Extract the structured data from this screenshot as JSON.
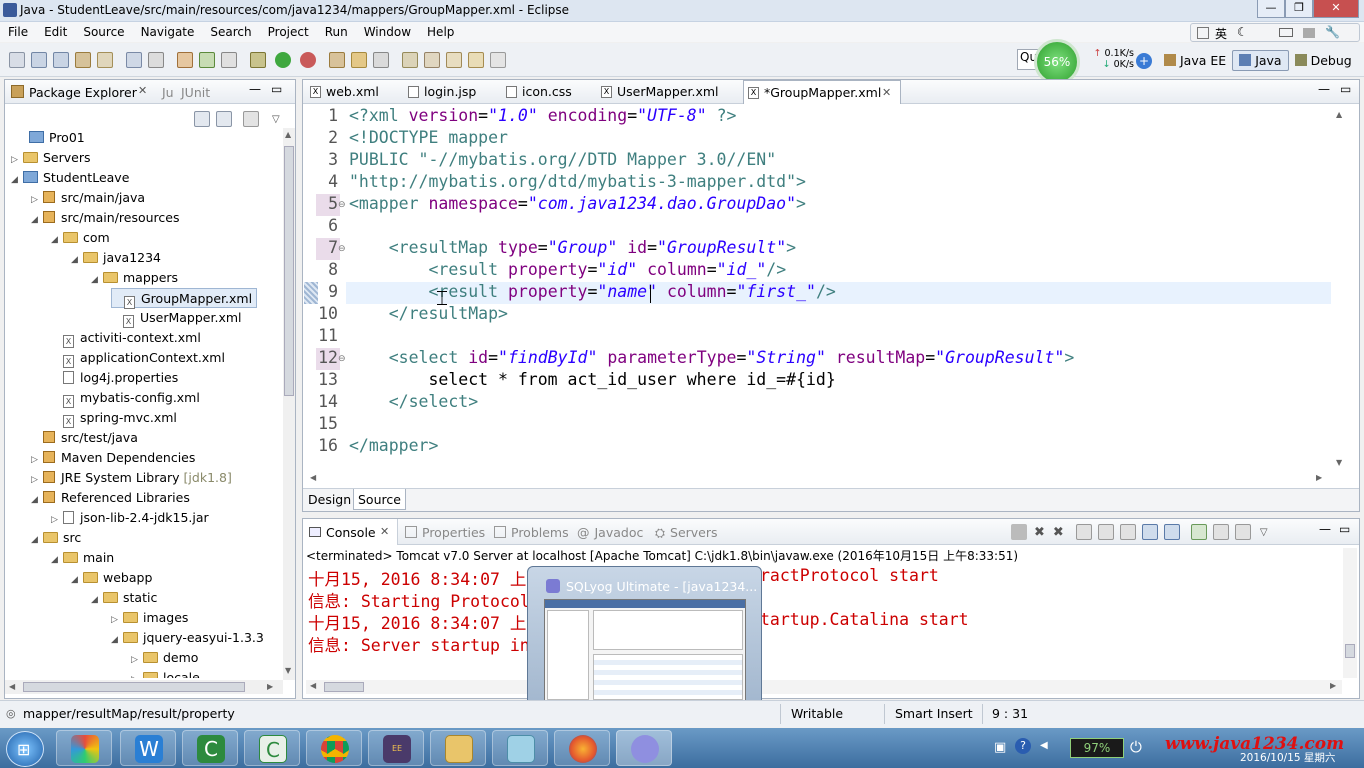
{
  "window": {
    "title": "Java - StudentLeave/src/main/resources/com/java1234/mappers/GroupMapper.xml - Eclipse"
  },
  "menu": [
    "File",
    "Edit",
    "Source",
    "Navigate",
    "Search",
    "Project",
    "Run",
    "Window",
    "Help"
  ],
  "toolbar": {
    "quick_access": "Qu",
    "cpu_percent": "56%",
    "net_up": "0.1K/s",
    "net_down": "0K/s",
    "perspectives": [
      "Java EE",
      "Java",
      "Debug"
    ],
    "ime": "英"
  },
  "package_explorer": {
    "title": "Package Explorer",
    "junit_tab": "JUnit",
    "tree": [
      {
        "label": "Pro01",
        "icon": "project-icon",
        "arrow": ""
      },
      {
        "label": "Servers",
        "icon": "folder-icon",
        "arrow": "▷"
      },
      {
        "label": "StudentLeave",
        "icon": "project-icon",
        "arrow": "◢"
      },
      {
        "label": "src/main/java",
        "icon": "package-folder-icon",
        "arrow": "▷"
      },
      {
        "label": "src/main/resources",
        "icon": "package-folder-icon",
        "arrow": "◢"
      },
      {
        "label": "com",
        "icon": "folder-icon",
        "arrow": "◢"
      },
      {
        "label": "java1234",
        "icon": "folder-icon",
        "arrow": "◢"
      },
      {
        "label": "mappers",
        "icon": "folder-icon",
        "arrow": "◢"
      },
      {
        "label": "GroupMapper.xml",
        "icon": "xml-file-icon",
        "arrow": ""
      },
      {
        "label": "UserMapper.xml",
        "icon": "xml-file-icon",
        "arrow": ""
      },
      {
        "label": "activiti-context.xml",
        "icon": "xml-file-icon",
        "arrow": ""
      },
      {
        "label": "applicationContext.xml",
        "icon": "xml-file-icon",
        "arrow": ""
      },
      {
        "label": "log4j.properties",
        "icon": "properties-file-icon",
        "arrow": ""
      },
      {
        "label": "mybatis-config.xml",
        "icon": "xml-file-icon",
        "arrow": ""
      },
      {
        "label": "spring-mvc.xml",
        "icon": "xml-file-icon",
        "arrow": ""
      },
      {
        "label": "src/test/java",
        "icon": "package-folder-icon",
        "arrow": ""
      },
      {
        "label": "Maven Dependencies",
        "icon": "library-icon",
        "arrow": "▷"
      },
      {
        "label": "JRE System Library",
        "suffix": "[jdk1.8]",
        "icon": "library-icon",
        "arrow": "▷"
      },
      {
        "label": "Referenced Libraries",
        "icon": "library-icon",
        "arrow": "◢"
      },
      {
        "label": "json-lib-2.4-jdk15.jar",
        "icon": "jar-icon",
        "arrow": "▷"
      },
      {
        "label": "src",
        "icon": "folder-icon",
        "arrow": "◢"
      },
      {
        "label": "main",
        "icon": "folder-icon",
        "arrow": "◢"
      },
      {
        "label": "webapp",
        "icon": "folder-icon",
        "arrow": "◢"
      },
      {
        "label": "static",
        "icon": "folder-icon",
        "arrow": "◢"
      },
      {
        "label": "images",
        "icon": "folder-icon",
        "arrow": "▷"
      },
      {
        "label": "jquery-easyui-1.3.3",
        "icon": "folder-icon",
        "arrow": "◢"
      },
      {
        "label": "demo",
        "icon": "folder-icon",
        "arrow": "▷"
      },
      {
        "label": "locale",
        "icon": "folder-icon",
        "arrow": "▷"
      }
    ]
  },
  "editor": {
    "tabs": [
      "web.xml",
      "login.jsp",
      "icon.css",
      "UserMapper.xml",
      "*GroupMapper.xml"
    ],
    "active_tab": "*GroupMapper.xml",
    "line_numbers": [
      "1",
      "2",
      "3",
      "4",
      "5",
      "6",
      "7",
      "8",
      "9",
      "10",
      "11",
      "12",
      "13",
      "14",
      "15",
      "16"
    ],
    "lines": [
      [
        [
          "tg",
          "<?xml "
        ],
        [
          "an",
          "version"
        ],
        [
          "pl",
          "="
        ],
        [
          "av",
          "\"1.0\""
        ],
        [
          "pl",
          " "
        ],
        [
          "an",
          "encoding"
        ],
        [
          "pl",
          "="
        ],
        [
          "av",
          "\"UTF-8\""
        ],
        [
          "tg",
          " ?>"
        ]
      ],
      [
        [
          "tg",
          "<!DOCTYPE mapper"
        ]
      ],
      [
        [
          "tg",
          "PUBLIC \"-//mybatis.org//DTD Mapper 3.0//EN\""
        ]
      ],
      [
        [
          "tg",
          "\"http://mybatis.org/dtd/mybatis-3-mapper.dtd\">"
        ]
      ],
      [
        [
          "tg",
          "<mapper "
        ],
        [
          "an",
          "namespace"
        ],
        [
          "pl",
          "="
        ],
        [
          "av",
          "\"com.java1234.dao.GroupDao\""
        ],
        [
          "tg",
          ">"
        ]
      ],
      [],
      [
        [
          "pl",
          "    "
        ],
        [
          "tg",
          "<resultMap "
        ],
        [
          "an",
          "type"
        ],
        [
          "pl",
          "="
        ],
        [
          "av",
          "\"Group\""
        ],
        [
          "pl",
          " "
        ],
        [
          "an",
          "id"
        ],
        [
          "pl",
          "="
        ],
        [
          "av",
          "\"GroupResult\""
        ],
        [
          "tg",
          ">"
        ]
      ],
      [
        [
          "pl",
          "        "
        ],
        [
          "tg",
          "<result "
        ],
        [
          "an",
          "property"
        ],
        [
          "pl",
          "="
        ],
        [
          "av",
          "\"id\""
        ],
        [
          "pl",
          " "
        ],
        [
          "an",
          "column"
        ],
        [
          "pl",
          "="
        ],
        [
          "av",
          "\"id_\""
        ],
        [
          "tg",
          "/>"
        ]
      ],
      [
        [
          "pl",
          "        "
        ],
        [
          "tg",
          "<result "
        ],
        [
          "an",
          "property"
        ],
        [
          "pl",
          "="
        ],
        [
          "av",
          "\"name\""
        ],
        [
          "pl",
          " "
        ],
        [
          "an",
          "column"
        ],
        [
          "pl",
          "="
        ],
        [
          "av",
          "\"first_\""
        ],
        [
          "tg",
          "/>"
        ]
      ],
      [
        [
          "pl",
          "    "
        ],
        [
          "tg",
          "</resultMap>"
        ]
      ],
      [],
      [
        [
          "pl",
          "    "
        ],
        [
          "tg",
          "<select "
        ],
        [
          "an",
          "id"
        ],
        [
          "pl",
          "="
        ],
        [
          "av",
          "\"findById\""
        ],
        [
          "pl",
          " "
        ],
        [
          "an",
          "parameterType"
        ],
        [
          "pl",
          "="
        ],
        [
          "av",
          "\"String\""
        ],
        [
          "pl",
          " "
        ],
        [
          "an",
          "resultMap"
        ],
        [
          "pl",
          "="
        ],
        [
          "av",
          "\"GroupResult\""
        ],
        [
          "tg",
          ">"
        ]
      ],
      [
        [
          "pl",
          "        select * from act_id_user where id_=#{id}"
        ]
      ],
      [
        [
          "pl",
          "    "
        ],
        [
          "tg",
          "</select>"
        ]
      ],
      [],
      [
        [
          "tg",
          "</mapper>"
        ]
      ]
    ],
    "bottom_tabs": [
      "Design",
      "Source"
    ]
  },
  "console": {
    "tabs": [
      "Console",
      "Properties",
      "Problems",
      "Javadoc",
      "Servers"
    ],
    "terminated": "<terminated> Tomcat v7.0 Server at localhost [Apache Tomcat] C:\\jdk1.8\\bin\\javaw.exe (2016年10月15日 上午8:33:51)",
    "lines": [
      "十月15, 2016 8:34:07 上",
      "信息: Starting Protocol",
      "十月15, 2016 8:34:07 上",
      "信息: Server startup in"
    ],
    "right_fragments": [
      "ractProtocol start",
      "tartup.Catalina start"
    ]
  },
  "popup": {
    "title": "SQLyog Ultimate - [java1234..."
  },
  "statusbar": {
    "path": "mapper/resultMap/result/property",
    "writable": "Writable",
    "insert_mode": "Smart Insert",
    "position": "9 : 31"
  },
  "taskbar": {
    "battery": "97%",
    "watermark": "www.java1234.com",
    "date": "2016/10/15 星期六"
  }
}
